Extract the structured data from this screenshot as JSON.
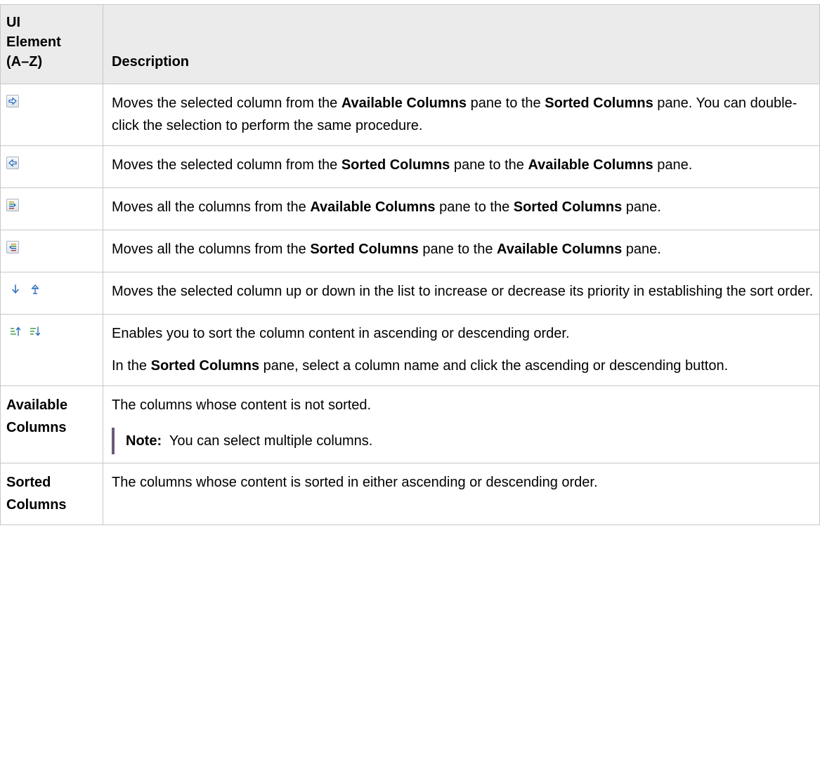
{
  "header": {
    "col1": "UI Element (A–Z)",
    "col1_lines": [
      "UI",
      "Element",
      "(A–Z)"
    ],
    "col2": "Description"
  },
  "rows": [
    {
      "icon": "move-right-arrow-icon",
      "desc": {
        "t1": "Moves the selected column from the ",
        "b1": "Available Columns",
        "t2": " pane to the ",
        "b2": "Sorted Columns",
        "t3": " pane. You can double-click the selection to perform the same procedure."
      }
    },
    {
      "icon": "move-left-arrow-icon",
      "desc": {
        "t1": "Moves the selected column from the ",
        "b1": "Sorted Columns",
        "t2": " pane to the ",
        "b2": "Available Columns",
        "t3": " pane."
      }
    },
    {
      "icon": "move-all-right-icon",
      "desc": {
        "t1": "Moves all the columns from the ",
        "b1": "Available Columns",
        "t2": " pane to the ",
        "b2": "Sorted Columns",
        "t3": " pane."
      }
    },
    {
      "icon": "move-all-left-icon",
      "desc": {
        "t1": "Moves all the columns from the ",
        "b1": "Sorted Columns",
        "t2": " pane to the ",
        "b2": "Available Columns",
        "t3": " pane."
      }
    },
    {
      "icons": [
        "move-down-arrow-icon",
        "move-up-arrow-icon"
      ],
      "desc": "Moves the selected column up or down in the list to increase or decrease its priority in establishing the sort order."
    },
    {
      "icons": [
        "sort-ascending-icon",
        "sort-descending-icon"
      ],
      "desc_p1": "Enables you to sort the column content in ascending or descending order.",
      "desc_p2": {
        "t1": "In the ",
        "b1": "Sorted Columns",
        "t2": " pane, select a column name and click the ascending or descending button."
      }
    },
    {
      "name": "Available Columns",
      "desc": "The columns whose content is not sorted.",
      "note_label": "Note:",
      "note_text": "You can select multiple columns."
    },
    {
      "name": "Sorted Columns",
      "desc": "The columns whose content is sorted in either ascending or descending order."
    }
  ],
  "colors": {
    "header_bg": "#ebebeb",
    "border": "#c8c8c8",
    "note_bar": "#6b5b7a",
    "icon_blue": "#2f6fc0",
    "icon_green": "#3a9a3a"
  }
}
